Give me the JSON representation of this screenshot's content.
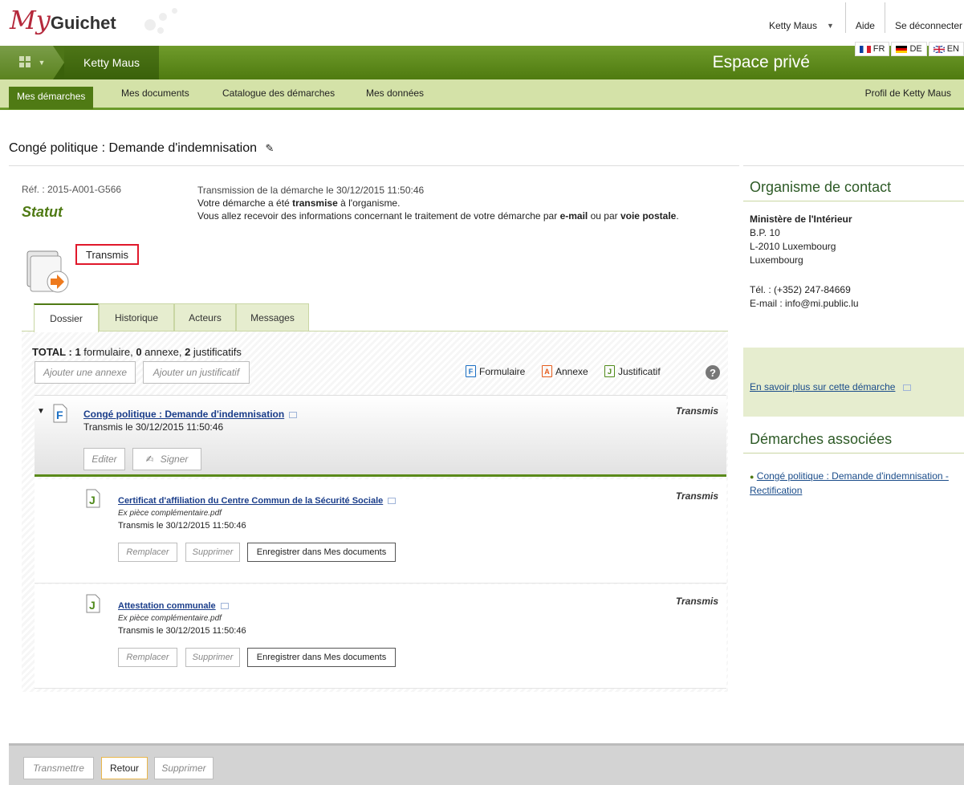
{
  "header": {
    "logo_my": "My",
    "logo_guichet": "Guichet",
    "user_name": "Ketty Maus",
    "aide": "Aide",
    "logout": "Se déconnecter",
    "espace": "Espace privé",
    "languages": [
      {
        "code": "FR"
      },
      {
        "code": "DE"
      },
      {
        "code": "EN"
      }
    ]
  },
  "subnav": {
    "items": [
      {
        "label": "Mes démarches"
      },
      {
        "label": "Mes documents"
      },
      {
        "label": "Catalogue des démarches"
      },
      {
        "label": "Mes données"
      }
    ],
    "profile": "Profil de Ketty Maus"
  },
  "page": {
    "title": "Congé politique : Demande d'indemnisation",
    "ref": "Réf. : 2015-A001-G566",
    "statut": "Statut",
    "status_badge": "Transmis",
    "transmission_line": "Transmission de la démarche le 30/12/2015 11:50:46",
    "line2_pre": "Votre démarche a été ",
    "line2_bold": "transmise",
    "line2_post": " à l'organisme.",
    "line3_pre": "Vous allez recevoir des informations concernant le traitement de votre démarche par ",
    "line3_b1": "e-mail",
    "line3_mid": " ou par ",
    "line3_b2": "voie postale",
    "line3_post": "."
  },
  "tabs": [
    {
      "label": "Dossier"
    },
    {
      "label": "Historique"
    },
    {
      "label": "Acteurs"
    },
    {
      "label": "Messages"
    }
  ],
  "dossier": {
    "total_label": "TOTAL : ",
    "n_formulaire": "1",
    "formulaire": " formulaire, ",
    "n_annexe": "0",
    "annexe": " annexe, ",
    "n_justif": "2",
    "justif": " justificatifs",
    "btn_add_annexe": "Ajouter une annexe",
    "btn_add_justif": "Ajouter un justificatif",
    "legend_formulaire": "Formulaire",
    "legend_annexe": "Annexe",
    "legend_justificatif": "Justificatif",
    "main_doc": {
      "title": "Congé politique : Demande d'indemnisation",
      "sub": "Transmis le 30/12/2015 11:50:46",
      "status": "Transmis",
      "btn_edit": "Editer",
      "btn_sign": "Signer"
    },
    "justificatifs": [
      {
        "title": "Certificat d'affiliation du Centre Commun de la Sécurité Sociale",
        "file": "Ex pièce complémentaire.pdf",
        "date": "Transmis le 30/12/2015 11:50:46",
        "status": "Transmis"
      },
      {
        "title": "Attestation communale",
        "file": "Ex pièce complémentaire.pdf",
        "date": "Transmis le 30/12/2015 11:50:46",
        "status": "Transmis"
      }
    ],
    "btn_replace": "Remplacer",
    "btn_delete": "Supprimer",
    "btn_save": "Enregistrer dans Mes documents"
  },
  "contact": {
    "title": "Organisme de contact",
    "org": "Ministère de l'Intérieur",
    "bp": "B.P. 10",
    "city": "L-2010 Luxembourg",
    "country": "Luxembourg",
    "tel": "Tél. : (+352) 247-84669",
    "email": "E-mail : info@mi.public.lu",
    "more": "En savoir plus sur cette démarche",
    "assoc_title": "Démarches associées",
    "assoc_link": "Congé politique : Demande d'indemnisation - Rectification"
  },
  "footer": {
    "transmettre": "Transmettre",
    "retour": "Retour",
    "supprimer": "Supprimer"
  },
  "colors": {
    "brand_green": "#4f7a14",
    "brand_red": "#b5283b",
    "highlight_red": "#e0182b"
  }
}
